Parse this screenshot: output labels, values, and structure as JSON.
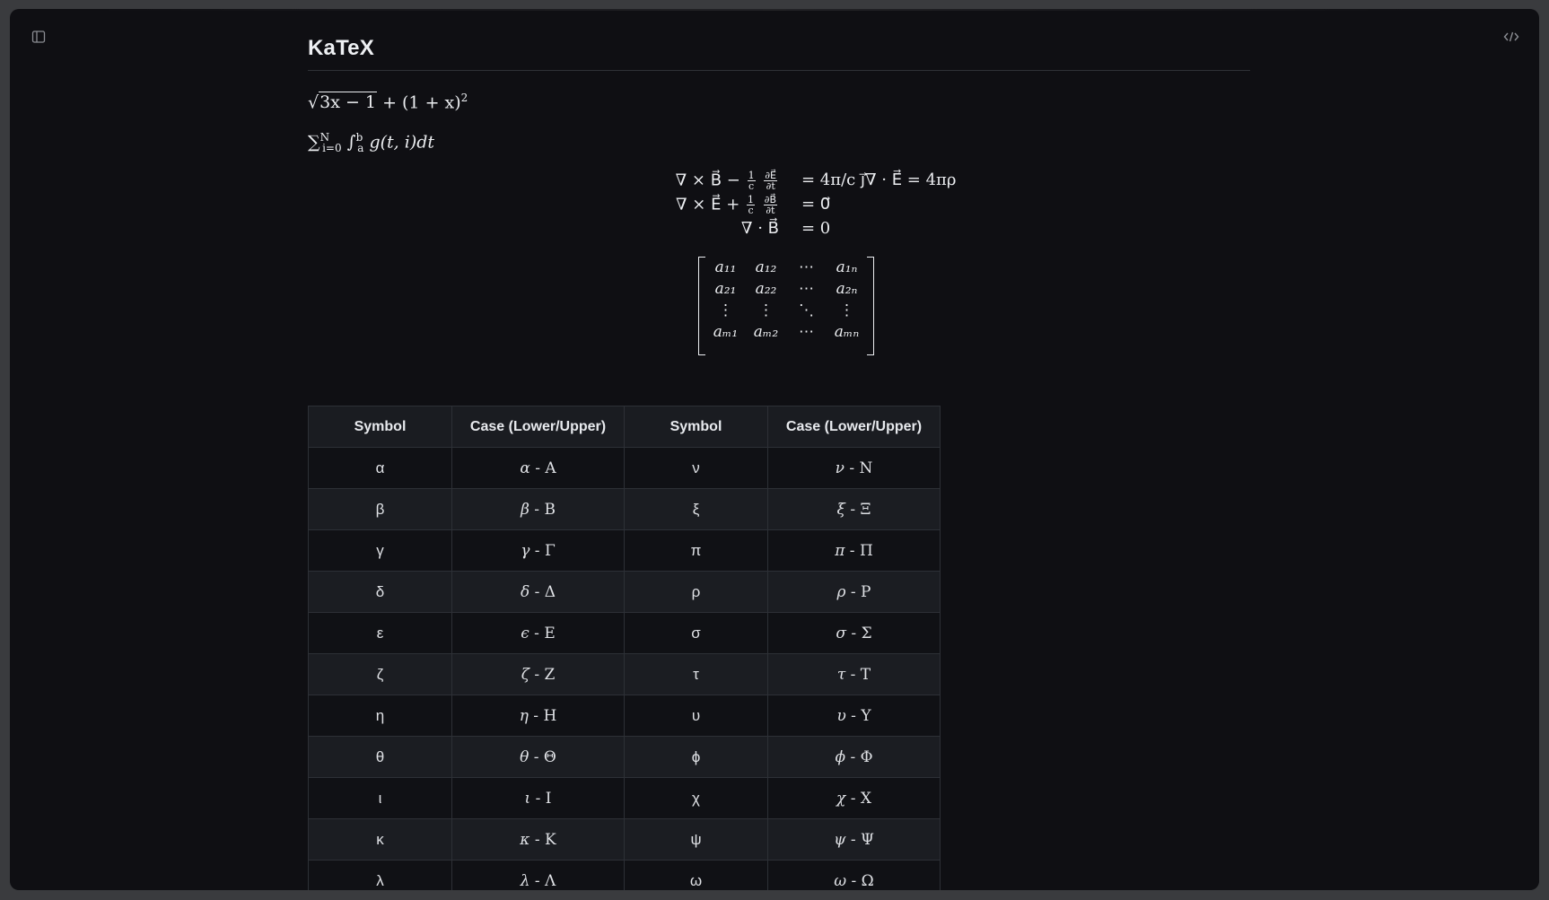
{
  "page": {
    "title": "KaTeX"
  },
  "icons": {
    "sidebar": "sidebar-panel-icon",
    "code": "code-brackets-icon"
  },
  "colors": {
    "background": "#0f0f13",
    "frame": "#3a3b3e",
    "text": "#e6e7ea",
    "table_border": "#2d3036"
  },
  "math": {
    "eq1_sqrt_inner": "3x − 1",
    "eq1_rest": "+ (1 + x)",
    "eq1_exp": "2",
    "eq2_sum": "∑",
    "eq2_sum_sup": "N",
    "eq2_sum_sub": "i=0",
    "eq2_int": "∫",
    "eq2_int_sup": "b",
    "eq2_int_sub": "a",
    "eq2_body": "g(t, i)dt",
    "maxwell": [
      {
        "lhs_pre": "∇ × B⃗ −",
        "frac_num": "1",
        "frac_den": "c",
        "frac2_num": "∂E⃗",
        "frac2_den": "∂t",
        "rhs": "= 4π/c j⃗∇ · E⃗   = 4πρ"
      },
      {
        "lhs_pre": "∇ × E⃗ +",
        "frac_num": "1",
        "frac_den": "c",
        "frac2_num": "∂B⃗",
        "frac2_den": "∂t",
        "rhs": "= 0⃗"
      },
      {
        "lhs_pre": "∇ · B⃗",
        "rhs": "= 0"
      }
    ],
    "matrix": [
      [
        "a₁₁",
        "a₁₂",
        "⋯",
        "a₁ₙ"
      ],
      [
        "a₂₁",
        "a₂₂",
        "⋯",
        "a₂ₙ"
      ],
      [
        "⋮",
        "⋮",
        "⋱",
        "⋮"
      ],
      [
        "aₘ₁",
        "aₘ₂",
        "⋯",
        "aₘₙ"
      ]
    ]
  },
  "table": {
    "headers": [
      "Symbol",
      "Case (Lower/Upper)",
      "Symbol",
      "Case (Lower/Upper)"
    ],
    "rows": [
      [
        "α",
        "α - A",
        "ν",
        "ν - N"
      ],
      [
        "β",
        "β - B",
        "ξ",
        "ξ - Ξ"
      ],
      [
        "γ",
        "γ - Γ",
        "π",
        "π - Π"
      ],
      [
        "δ",
        "δ - Δ",
        "ρ",
        "ρ - P"
      ],
      [
        "ε",
        "ϵ - E",
        "σ",
        "σ - Σ"
      ],
      [
        "ζ",
        "ζ - Z",
        "τ",
        "τ - T"
      ],
      [
        "η",
        "η - H",
        "υ",
        "υ - Υ"
      ],
      [
        "θ",
        "θ - Θ",
        "ϕ",
        "ϕ - Φ"
      ],
      [
        "ι",
        "ι - I",
        "χ",
        "χ - X"
      ],
      [
        "κ",
        "κ - K",
        "ψ",
        "ψ - Ψ"
      ],
      [
        "λ",
        "λ - Λ",
        "ω",
        "ω - Ω"
      ]
    ]
  }
}
